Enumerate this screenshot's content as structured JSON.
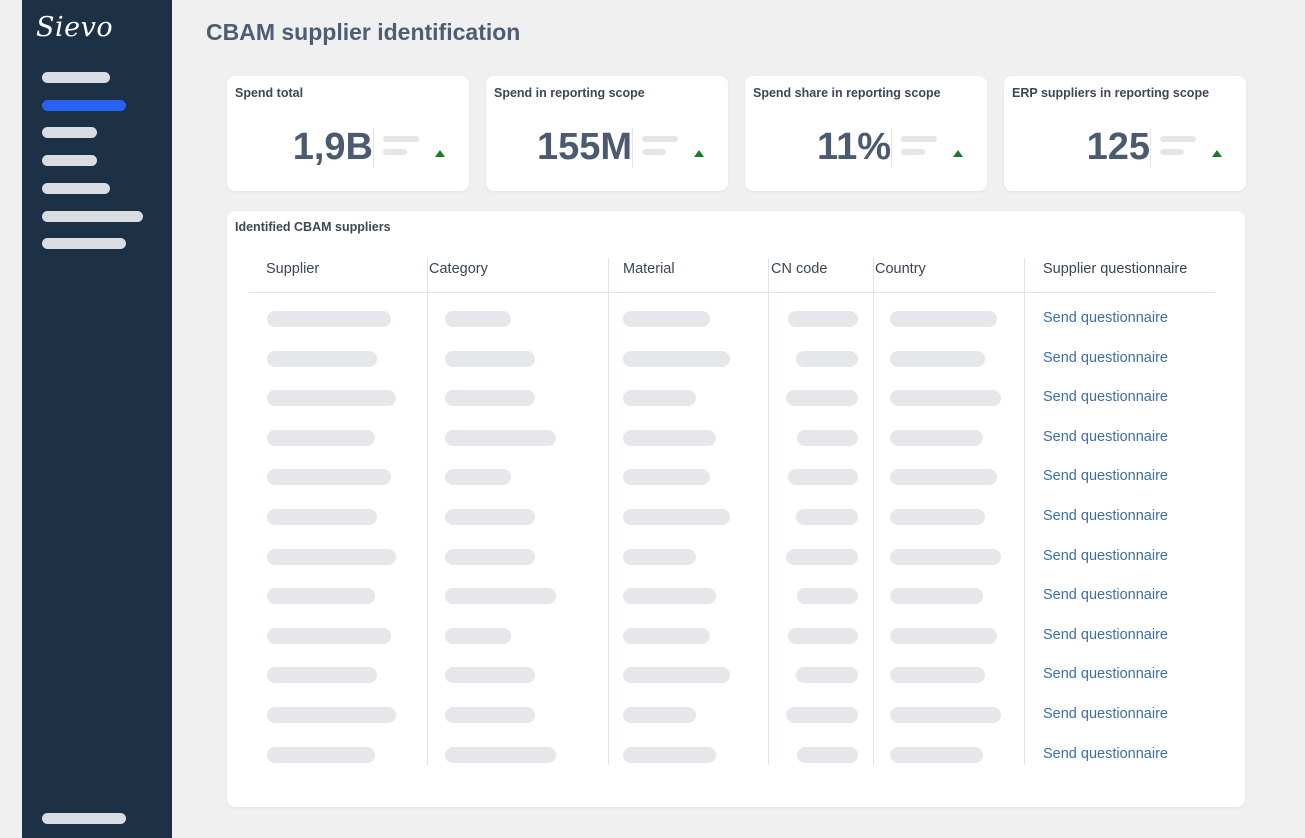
{
  "app": {
    "logo": "Sievo"
  },
  "sidebar": {
    "active_index": 1
  },
  "page": {
    "title": "CBAM supplier identification"
  },
  "kpis": [
    {
      "label": "Spend total",
      "value": "1,9B",
      "trend": "up"
    },
    {
      "label": "Spend in reporting scope",
      "value": "155M",
      "trend": "up"
    },
    {
      "label": "Spend share in reporting scope",
      "value": "11%",
      "trend": "up"
    },
    {
      "label": "ERP suppliers in reporting scope",
      "value": "125",
      "trend": "up"
    }
  ],
  "table": {
    "title": "Identified CBAM suppliers",
    "columns": [
      "Supplier",
      "Category",
      "Material",
      "CN code",
      "Country",
      "Supplier questionnaire"
    ],
    "rows": [
      {
        "action": "Send questionnaire"
      },
      {
        "action": "Send questionnaire"
      },
      {
        "action": "Send questionnaire"
      },
      {
        "action": "Send questionnaire"
      },
      {
        "action": "Send questionnaire"
      },
      {
        "action": "Send questionnaire"
      },
      {
        "action": "Send questionnaire"
      },
      {
        "action": "Send questionnaire"
      },
      {
        "action": "Send questionnaire"
      },
      {
        "action": "Send questionnaire"
      },
      {
        "action": "Send questionnaire"
      },
      {
        "action": "Send questionnaire"
      }
    ]
  },
  "colors": {
    "sidebar": "#1c3046",
    "accent": "#2563f0",
    "link": "#3d6ea8",
    "trend_up": "#1d7a2a"
  }
}
